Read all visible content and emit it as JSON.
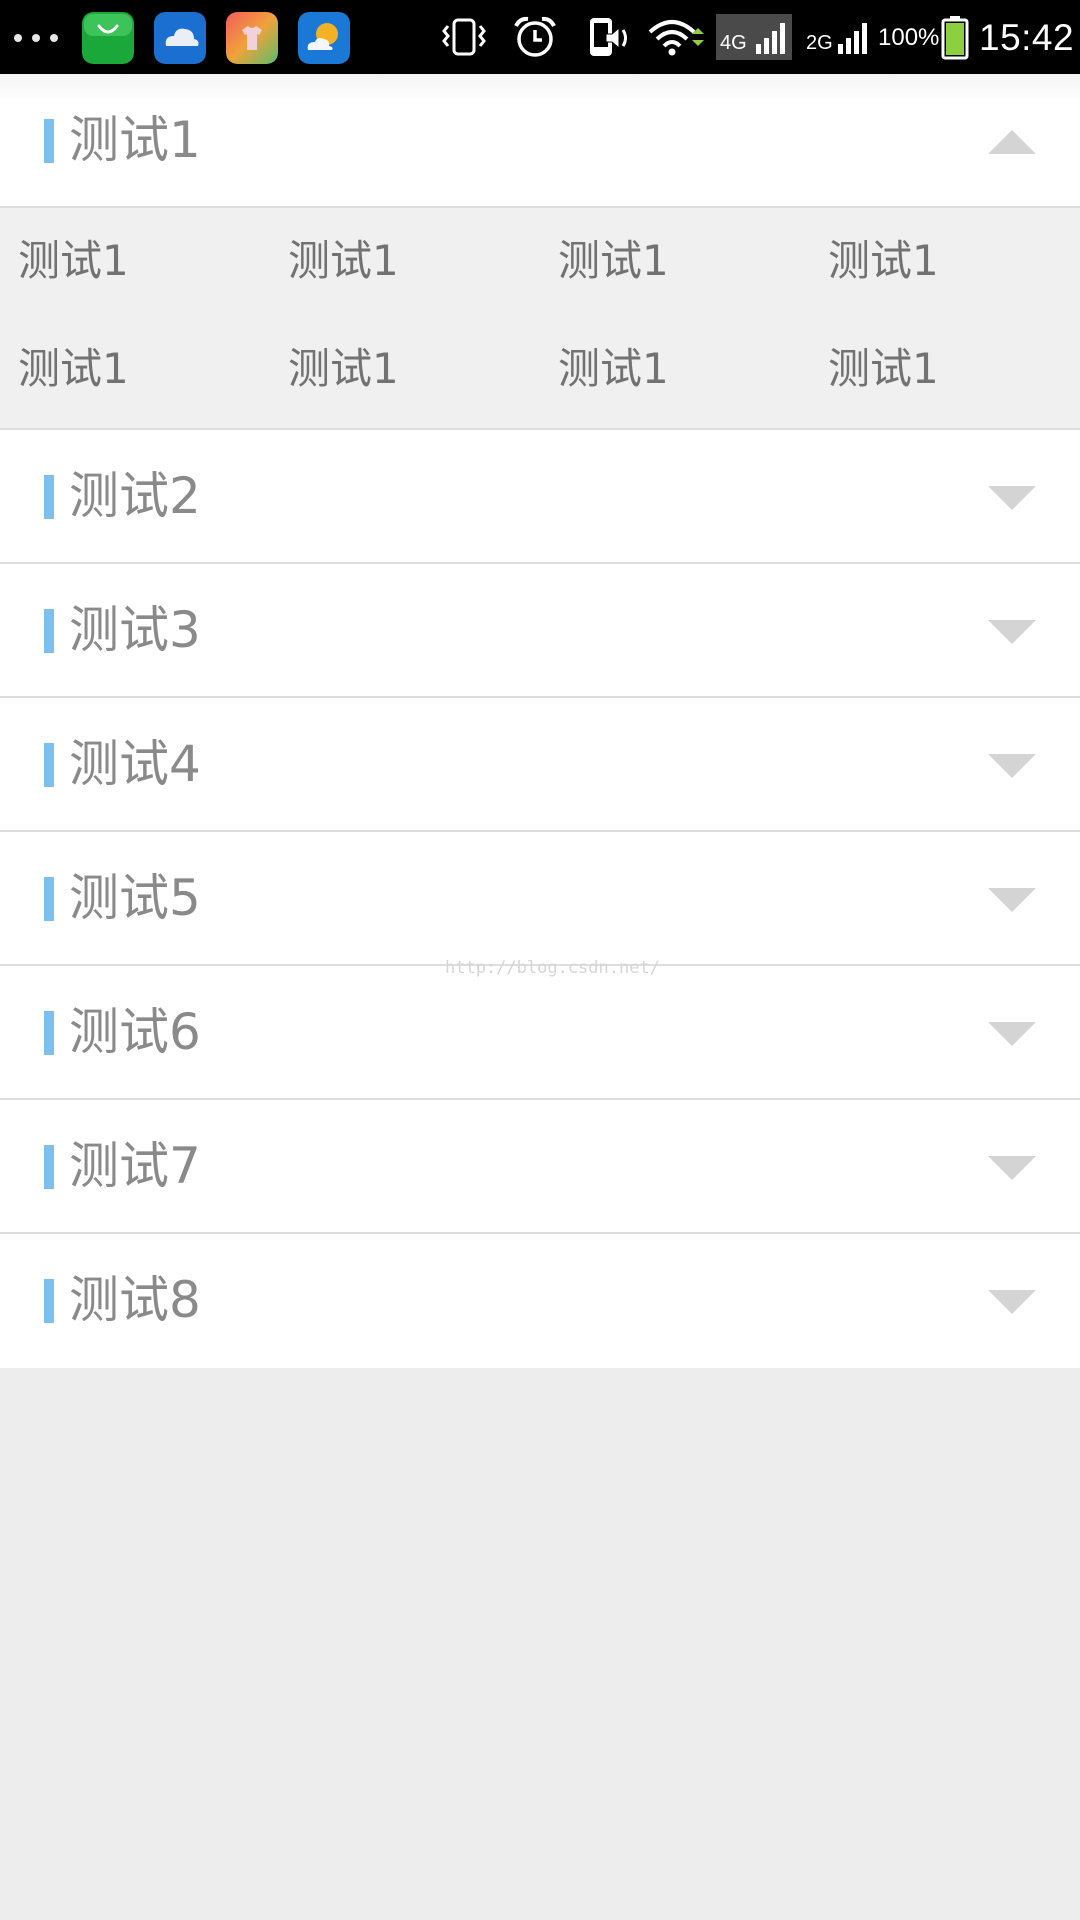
{
  "status_bar": {
    "battery_percent": "100%",
    "time": "15:42",
    "network_4g": "4G",
    "network_2g": "2G",
    "icons": [
      "more-dots-icon",
      "app-store-icon",
      "cloud-app-icon",
      "theme-app-icon",
      "weather-app-icon",
      "vibrate-icon",
      "alarm-icon",
      "phone-speaker-icon",
      "wifi-icon",
      "signal-4g-icon",
      "signal-2g-icon",
      "battery-icon"
    ]
  },
  "groups": [
    {
      "title": "测试1",
      "expanded": true,
      "children": [
        "测试1",
        "测试1",
        "测试1",
        "测试1",
        "测试1",
        "测试1",
        "测试1",
        "测试1"
      ]
    },
    {
      "title": "测试2",
      "expanded": false
    },
    {
      "title": "测试3",
      "expanded": false
    },
    {
      "title": "测试4",
      "expanded": false
    },
    {
      "title": "测试5",
      "expanded": false
    },
    {
      "title": "测试6",
      "expanded": false
    },
    {
      "title": "测试7",
      "expanded": false
    },
    {
      "title": "测试8",
      "expanded": false
    }
  ],
  "watermark": "http://blog.csdn.net/",
  "colors": {
    "accent": "#7dbfee",
    "title_text": "#8a8a8a",
    "child_text": "#727272",
    "children_bg": "#f0f0f0",
    "page_bg": "#ededed",
    "arrow": "#d4d4d4"
  }
}
